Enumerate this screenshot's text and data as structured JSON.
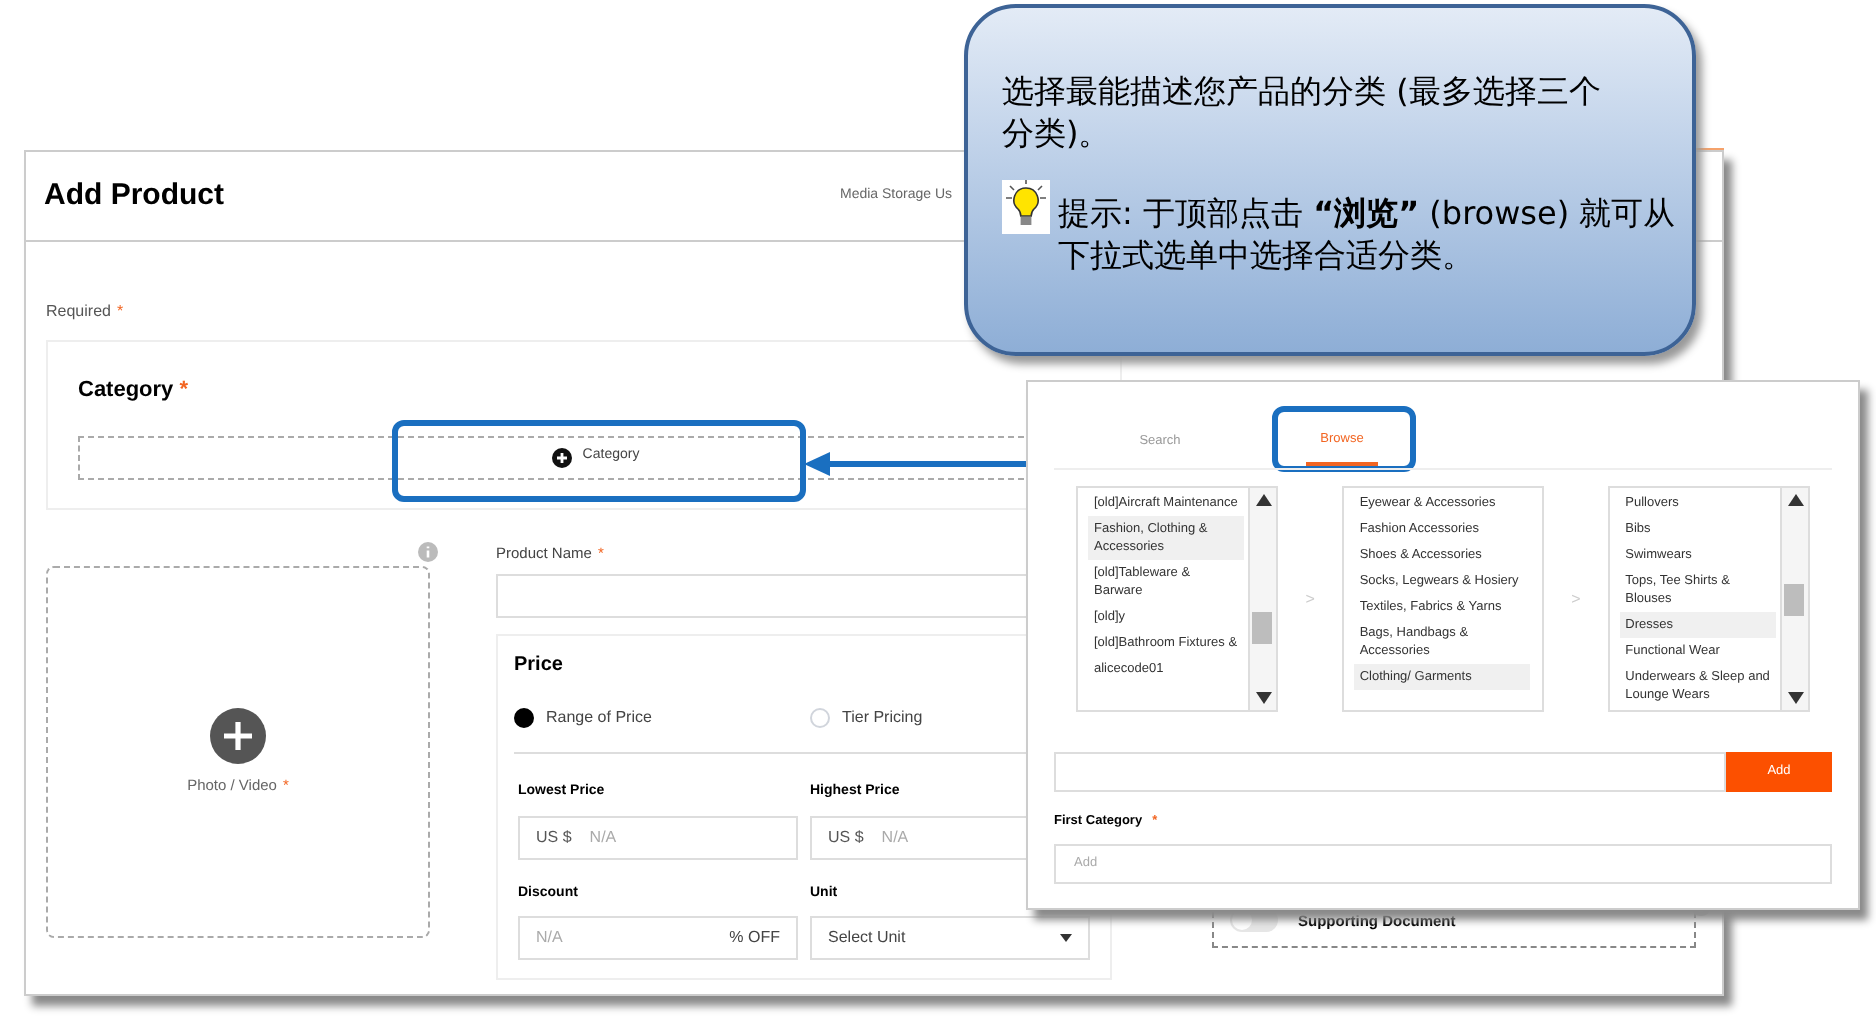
{
  "page": {
    "title": "Add Product",
    "media_storage": "Media Storage Us",
    "required_label": "Required",
    "required_mark": "*",
    "category": {
      "title": "Category",
      "mark": "*",
      "button": "Category"
    },
    "photo": {
      "label": "Photo / Video",
      "mark": "*"
    },
    "product_name": {
      "label": "Product Name",
      "mark": "*"
    },
    "price": {
      "title": "Price",
      "options": [
        {
          "label": "Range of Price",
          "selected": true
        },
        {
          "label": "Tier Pricing",
          "selected": false
        }
      ],
      "lowest": {
        "label": "Lowest Price",
        "prefix": "US $",
        "placeholder": "N/A"
      },
      "highest": {
        "label": "Highest Price",
        "prefix": "US $",
        "placeholder": "N/A"
      },
      "discount": {
        "label": "Discount",
        "placeholder": "N/A",
        "suffix": "% OFF"
      },
      "unit": {
        "label": "Unit",
        "value": "Select Unit"
      }
    },
    "supporting_document": {
      "label": "Supporting Document",
      "on": false
    }
  },
  "category_popup": {
    "tabs": [
      {
        "label": "Search",
        "selected": false
      },
      {
        "label": "Browse",
        "selected": true
      }
    ],
    "lists": [
      [
        {
          "label": "[old]Aircraft Maintenance",
          "selected": false
        },
        {
          "label": "Fashion, Clothing & Accessories",
          "selected": true
        },
        {
          "label": "[old]Tableware & Barware",
          "selected": false
        },
        {
          "label": "[old]y",
          "selected": false
        },
        {
          "label": "[old]Bathroom Fixtures &",
          "selected": false
        },
        {
          "label": "alicecode01",
          "selected": false
        }
      ],
      [
        {
          "label": "Eyewear & Accessories",
          "selected": false
        },
        {
          "label": "Fashion Accessories",
          "selected": false
        },
        {
          "label": "Shoes & Accessories",
          "selected": false
        },
        {
          "label": "Socks, Legwears & Hosiery",
          "selected": false
        },
        {
          "label": "Textiles, Fabrics & Yarns",
          "selected": false
        },
        {
          "label": "Bags, Handbags & Accessories",
          "selected": false
        },
        {
          "label": "Clothing/ Garments",
          "selected": true
        }
      ],
      [
        {
          "label": "Pullovers",
          "selected": false
        },
        {
          "label": "Bibs",
          "selected": false
        },
        {
          "label": "Swimwears",
          "selected": false
        },
        {
          "label": "Tops, Tee Shirts & Blouses",
          "selected": false
        },
        {
          "label": "Dresses",
          "selected": true
        },
        {
          "label": "Functional Wear",
          "selected": false
        },
        {
          "label": "Underwears & Sleep and Lounge Wears",
          "selected": false
        }
      ]
    ],
    "separators": [
      ">",
      ">"
    ],
    "add_button": "Add",
    "first_category": {
      "label": "First Category",
      "mark": "*",
      "placeholder": "Add"
    }
  },
  "callout": {
    "text": "选择最能描述您产品的分类 (最多选择三个分类)。",
    "tip": "提示: 于顶部点击 **“浏览”** (browse) 就可从下拉式选单中选择合适分类。"
  }
}
